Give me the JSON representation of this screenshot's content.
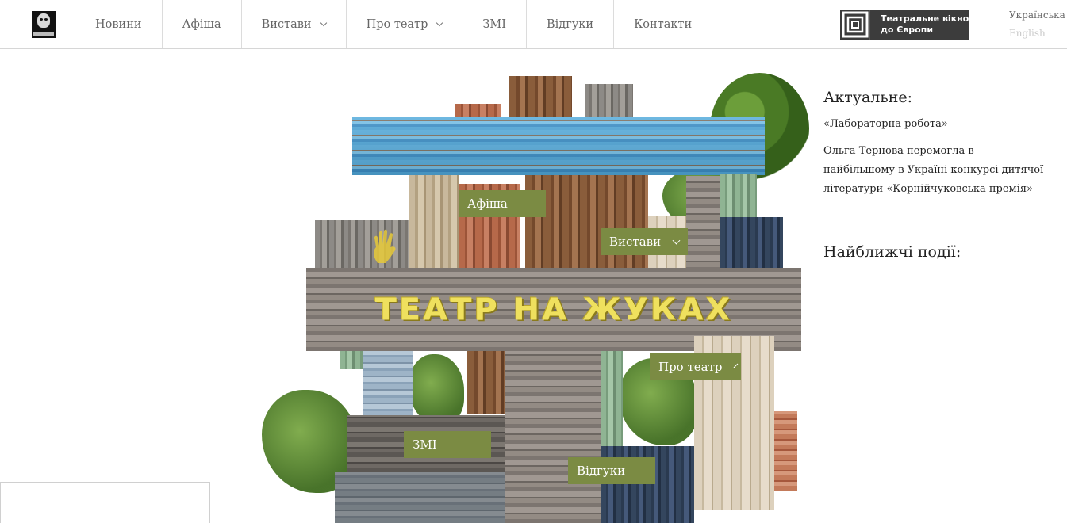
{
  "header": {
    "logo_icon": "theatre-logo-icon",
    "nav": [
      {
        "label": "Новини",
        "has_dropdown": false
      },
      {
        "label": "Афіша",
        "has_dropdown": false
      },
      {
        "label": "Вистави",
        "has_dropdown": true
      },
      {
        "label": "Про театр",
        "has_dropdown": true
      },
      {
        "label": "ЗМІ",
        "has_dropdown": false
      },
      {
        "label": "Відгуки",
        "has_dropdown": false
      },
      {
        "label": "Контакти",
        "has_dropdown": false
      }
    ],
    "partner_badge": {
      "line1": "Театральне вікно",
      "line2": "до Європи",
      "icon": "square-spiral-icon"
    },
    "languages": {
      "current": "Українська",
      "other": "English"
    }
  },
  "hero": {
    "title": "ТЕАТР НА ЖУКАХ",
    "tags": {
      "afisha": "Афіша",
      "vystavy": "Вистави",
      "pro_teatr": "Про театр",
      "zmi": "ЗМІ",
      "vidhuky": "Відгуки"
    }
  },
  "sidebar": {
    "actual_heading": "Актуальне:",
    "links": [
      "«Лабораторна робота»",
      "Ольга Тернова перемогла в найбільшому в Україні конкурсі дитячої літератури «Корнійчуковська премія»"
    ],
    "events_heading": "Найближчі події:"
  },
  "colors": {
    "tag_green": "#7b8b43",
    "title_yellow": "#efe05e",
    "badge_dark": "#3c3c3c"
  }
}
